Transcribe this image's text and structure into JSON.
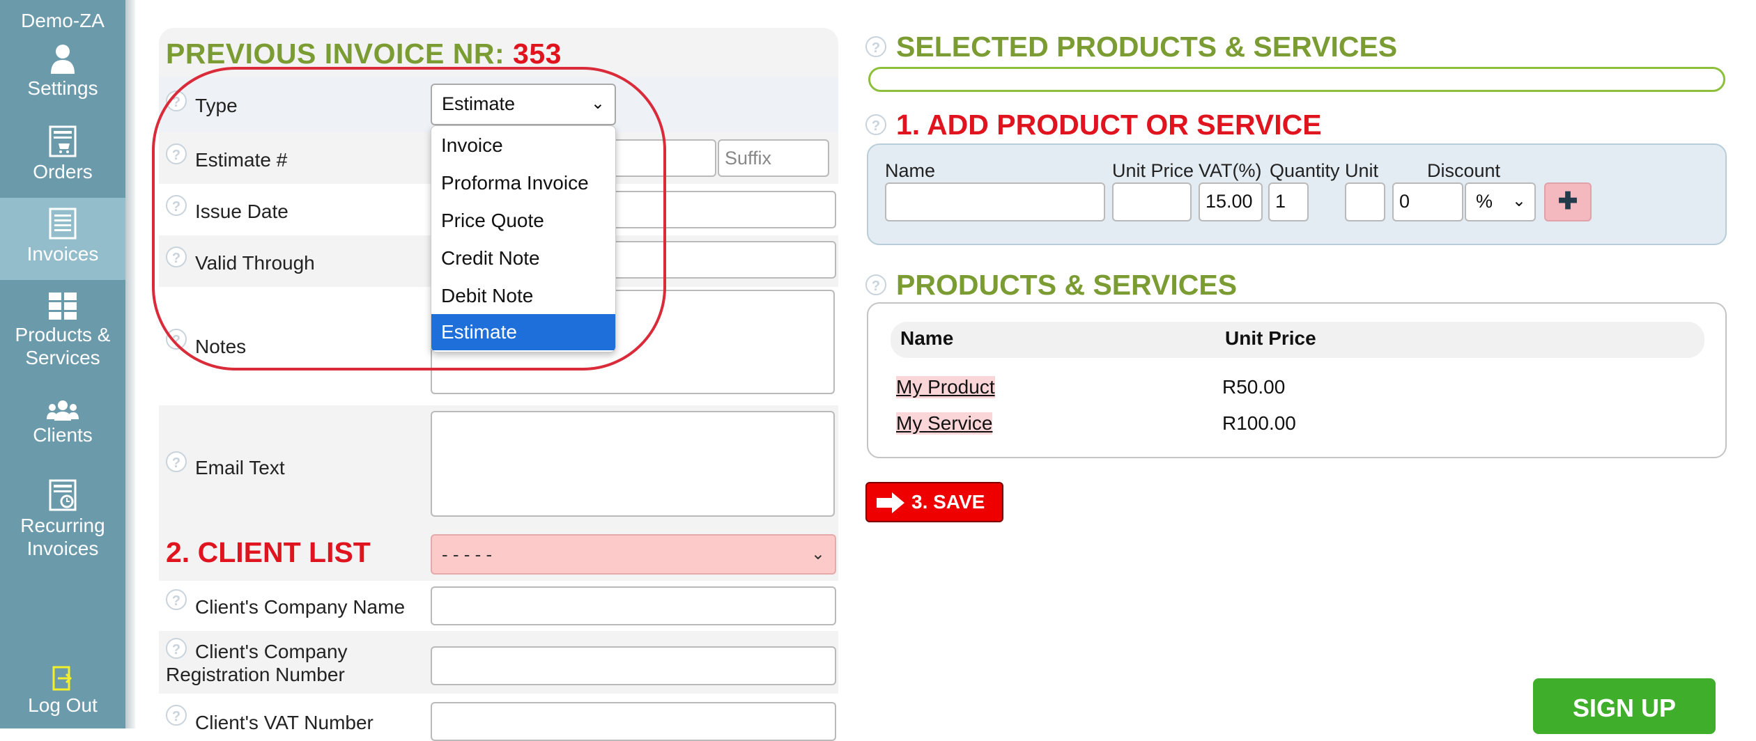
{
  "sidebar": {
    "brand": "Demo-ZA",
    "items": [
      {
        "label": "Settings",
        "icon": "user-icon"
      },
      {
        "label": "Orders",
        "icon": "cart-icon"
      },
      {
        "label": "Invoices",
        "icon": "document-icon",
        "active": true
      },
      {
        "label_line1": "Products &",
        "label_line2": "Services",
        "icon": "grid-icon"
      },
      {
        "label": "Clients",
        "icon": "group-icon"
      },
      {
        "label_line1": "Recurring",
        "label_line2": "Invoices",
        "icon": "calendar-clock-icon"
      }
    ],
    "logout": "Log Out"
  },
  "form": {
    "heading_prefix": "PREVIOUS INVOICE NR:",
    "heading_number": "353",
    "type_label": "Type",
    "type_value": "Estimate",
    "estimate_label": "Estimate #",
    "suffix_placeholder": "Suffix",
    "issue_date_label": "Issue Date",
    "valid_through_label": "Valid Through",
    "notes_label": "Notes",
    "email_text_label": "Email Text",
    "client_list_heading": "2. CLIENT LIST",
    "client_select_value": "- - - - -",
    "company_name_label": "Client's Company Name",
    "company_reg_label_line1": "Client's Company",
    "company_reg_label_line2": "Registration Number",
    "vat_number_label": "Client's VAT Number"
  },
  "type_dropdown": {
    "options": [
      "Invoice",
      "Proforma Invoice",
      "Price Quote",
      "Credit Note",
      "Debit Note",
      "Estimate"
    ],
    "selected": "Estimate"
  },
  "right": {
    "selected_heading": "SELECTED PRODUCTS & SERVICES",
    "add_heading": "1. ADD PRODUCT OR SERVICE",
    "columns": {
      "name": "Name",
      "unit_price": "Unit Price",
      "vat": "VAT(%)",
      "quantity": "Quantity",
      "unit": "Unit",
      "discount": "Discount"
    },
    "vat_value": "15.00",
    "quantity_value": "1",
    "discount_value": "0",
    "discount_type": "%",
    "products_heading": "PRODUCTS & SERVICES",
    "products_table": {
      "headers": [
        "Name",
        "Unit Price"
      ],
      "rows": [
        {
          "name": "My Product",
          "price": "R50.00"
        },
        {
          "name": "My Service",
          "price": "R100.00"
        }
      ]
    },
    "save_label": "3. SAVE",
    "signup_label": "SIGN UP"
  },
  "colors": {
    "sidebar": "#6b9aab",
    "sidebar_active": "#94bdcc",
    "heading_green": "#7a9c33",
    "heading_red": "#e0141e",
    "dropdown_selected": "#1e6fd9",
    "signup": "#3fae2a"
  }
}
